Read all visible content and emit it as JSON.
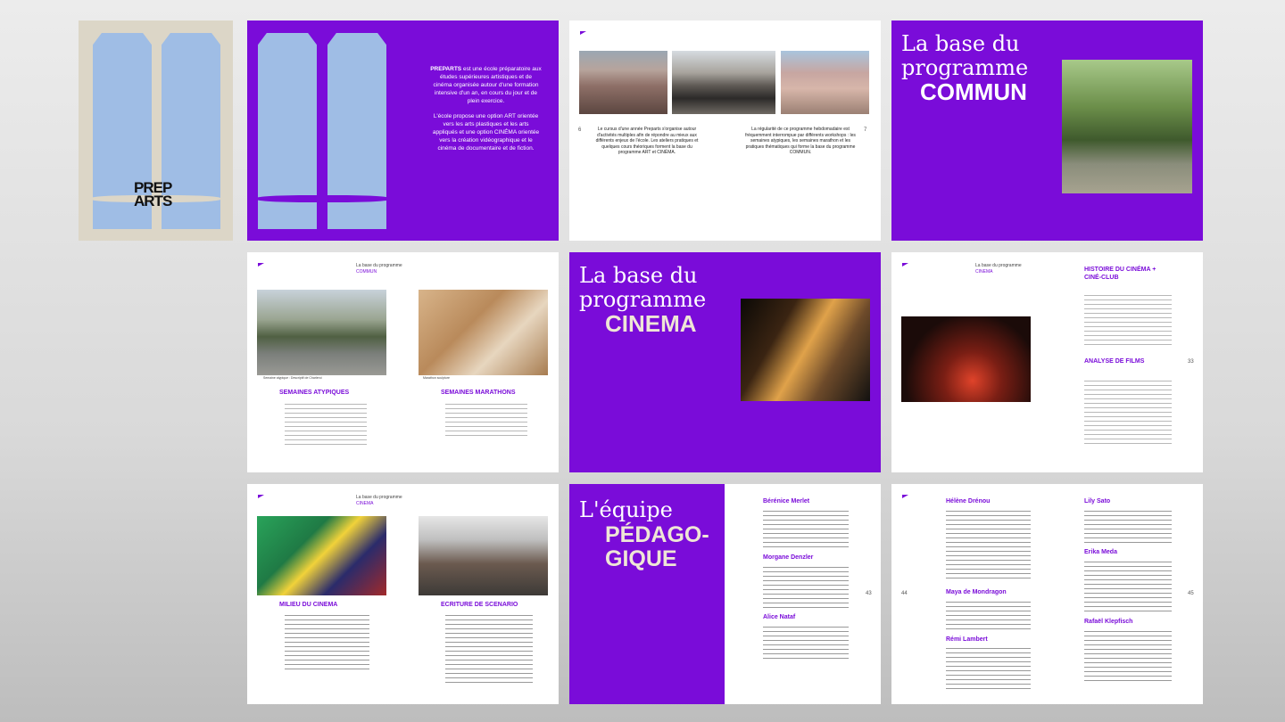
{
  "cover": {
    "brand_line1": "PREP",
    "brand_line2": "ARTS"
  },
  "intro": {
    "para1_strong": "PREPARTS",
    "para1": "est une école préparatoire aux études supérieures artistiques et de cinéma organisée autour d'une formation intensive d'un an, en cours du jour et de plein exercice.",
    "para2": "L'école propose une option ART orientée vers les arts plastiques et les arts appliqués et une option CINÉMA orientée vers la création vidéographique et le cinéma de documentaire et de fiction."
  },
  "spread1": {
    "page_left": "6",
    "page_right": "7",
    "text_left": "Le cursus d'une année Preparts s'organise autour d'activités multiples afin de répondre au mieux aux différents enjeux de l'école. Les ateliers pratiques et quelques cours théoriques forment la base du programme ART et CINÉMA.",
    "text_right": "La régularité de ce programme hebdomadaire est fréquemment interrompue par différents workshops : les semaines atypiques, les semaines marathon et les pratiques thématiques qui forme la base du programme COMMUN."
  },
  "commun": {
    "line1": "La base du",
    "line2": "programme",
    "line3": "COMMUN"
  },
  "semaines": {
    "title_left": "SEMAINES ATYPIQUES",
    "title_right": "SEMAINES MARATHONS",
    "caption_left": "Semaine atypique : Descriptif de Charleroi",
    "caption_right": "Marathon sculpture",
    "header_right_1": "La base du programme",
    "header_right_2": "COMMUN"
  },
  "cinema": {
    "line1": "La base du",
    "line2": "programme",
    "line3": "CINEMA"
  },
  "histoire": {
    "title1": "HISTOIRE DU CINÉMA +",
    "title1b": "CINÉ-CLUB",
    "title2": "ANALYSE DE FILMS",
    "page": "33",
    "header_1": "La base du programme",
    "header_2": "CINEMA"
  },
  "milieu": {
    "title_left": "MILIEU DU CINEMA",
    "title_right": "ECRITURE DE SCENARIO",
    "header_1": "La base du programme",
    "header_2": "CINEMA"
  },
  "equipe": {
    "line1": "L'équipe",
    "line2": "PÉDAGO-",
    "line3": "GIQUE",
    "names": [
      "Bérénice Merlet",
      "Morgane Denzler",
      "Alice Nataf"
    ],
    "page": "43"
  },
  "team2": {
    "names_left": [
      "Hélène Drénou",
      "Maya de Mondragon",
      "Rémi Lambert"
    ],
    "names_right": [
      "Lily Sato",
      "Erika Meda",
      "Rafaël Klepfisch"
    ],
    "page_left": "44",
    "page_right": "45"
  },
  "colors": {
    "accent": "#7a0cd9",
    "beige": "#dcd6c7",
    "window_blue": "#9fbde5"
  }
}
